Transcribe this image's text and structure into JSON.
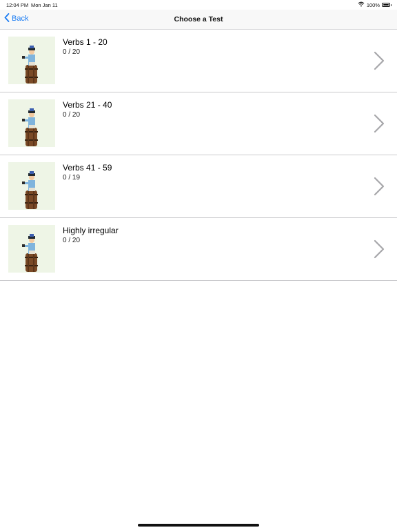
{
  "status_bar": {
    "time": "12:04 PM",
    "date": "Mon Jan 11",
    "battery": "100%",
    "icons": [
      "wifi-icon",
      "battery-icon"
    ]
  },
  "nav": {
    "back_label": "Back",
    "title": "Choose a Test"
  },
  "colors": {
    "accent": "#1a7cf3",
    "thumb_bg": "#eef5e6",
    "separator": "#c9c9cc",
    "chevron": "#a7a7aa"
  },
  "tests": [
    {
      "title": "Verbs 1 - 20",
      "progress": "0 / 20",
      "icon": "sailor-on-barrel-image",
      "chevron": "chevron-right-icon"
    },
    {
      "title": "Verbs 21 - 40",
      "progress": "0 / 20",
      "icon": "sailor-on-barrel-image",
      "chevron": "chevron-right-icon"
    },
    {
      "title": "Verbs 41 - 59",
      "progress": "0 / 19",
      "icon": "sailor-on-barrel-image",
      "chevron": "chevron-right-icon"
    },
    {
      "title": "Highly irregular",
      "progress": "0 / 20",
      "icon": "sailor-on-barrel-image",
      "chevron": "chevron-right-icon"
    }
  ]
}
